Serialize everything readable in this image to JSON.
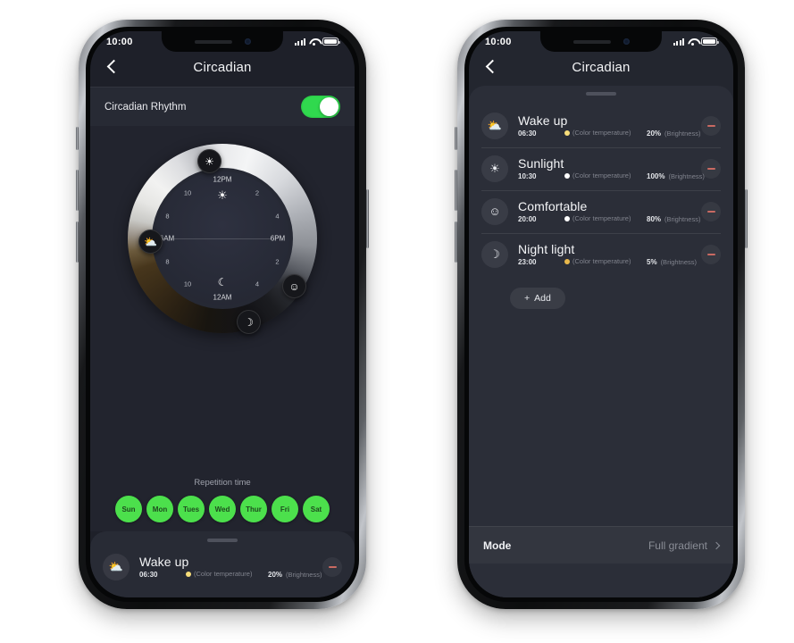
{
  "status_bar": {
    "time": "10:00",
    "signal_icon": "cellular-signal-icon",
    "wifi_icon": "wifi-icon",
    "battery_icon": "battery-icon"
  },
  "nav": {
    "back_icon": "back-chevron-icon",
    "title": "Circadian"
  },
  "left_phone": {
    "rhythm": {
      "label": "Circadian Rhythm",
      "enabled": true
    },
    "dial": {
      "top_label": "12PM",
      "bottom_label": "12AM",
      "left_label": "6AM",
      "right_label": "6PM",
      "ticks": [
        "2",
        "4",
        "6",
        "8",
        "10",
        "2",
        "4",
        "6",
        "8",
        "10"
      ],
      "center_top_icon": "sun-icon",
      "center_bottom_icon": "moon-icon",
      "handles": [
        {
          "icon": "sunrise-icon",
          "glyph": "⛅",
          "angle": 200
        },
        {
          "icon": "bright-sun-icon",
          "glyph": "☀",
          "angle": 335
        },
        {
          "icon": "smiley-icon",
          "glyph": "☺",
          "angle": 117
        },
        {
          "icon": "crescent-moon-icon",
          "glyph": "☽",
          "angle": 70
        }
      ]
    },
    "repetition": {
      "title": "Repetition time",
      "days": [
        "Sun",
        "Mon",
        "Tues",
        "Wed",
        "Thur",
        "Fri",
        "Sat"
      ],
      "active_color": "#4ce04c"
    },
    "sheet_schedule": {
      "icon": "sunrise-icon",
      "glyph": "⛅",
      "title": "Wake up",
      "time": "06:30",
      "color_temperature_label": "(Color temperature)",
      "color_temperature_swatch": "#f7dd7a",
      "brightness_value": "20%",
      "brightness_label": "(Brightness)",
      "remove_icon": "minus-icon"
    }
  },
  "right_phone": {
    "schedules": [
      {
        "icon": "sunrise-icon",
        "glyph": "⛅",
        "title": "Wake up",
        "time": "06:30",
        "color_temperature_label": "(Color temperature)",
        "color_temperature_swatch": "#f7dd7a",
        "brightness_value": "20%",
        "brightness_label": "(Brightness)",
        "remove_icon": "minus-icon"
      },
      {
        "icon": "bright-sun-icon",
        "glyph": "☀",
        "title": "Sunlight",
        "time": "10:30",
        "color_temperature_label": "(Color temperature)",
        "color_temperature_swatch": "#ffffff",
        "brightness_value": "100%",
        "brightness_label": "(Brightness)",
        "remove_icon": "minus-icon"
      },
      {
        "icon": "smiley-icon",
        "glyph": "☺",
        "title": "Comfortable",
        "time": "20:00",
        "color_temperature_label": "(Color temperature)",
        "color_temperature_swatch": "#ffffff",
        "brightness_value": "80%",
        "brightness_label": "(Brightness)",
        "remove_icon": "minus-icon"
      },
      {
        "icon": "crescent-moon-icon",
        "glyph": "☽",
        "title": "Night light",
        "time": "23:00",
        "color_temperature_label": "(Color temperature)",
        "color_temperature_swatch": "#e8b84b",
        "brightness_value": "5%",
        "brightness_label": "(Brightness)",
        "remove_icon": "minus-icon"
      }
    ],
    "add_button": {
      "plus_icon": "plus-icon",
      "label": "Add"
    },
    "mode": {
      "label": "Mode",
      "value": "Full gradient",
      "chevron_icon": "chevron-right-icon"
    }
  }
}
